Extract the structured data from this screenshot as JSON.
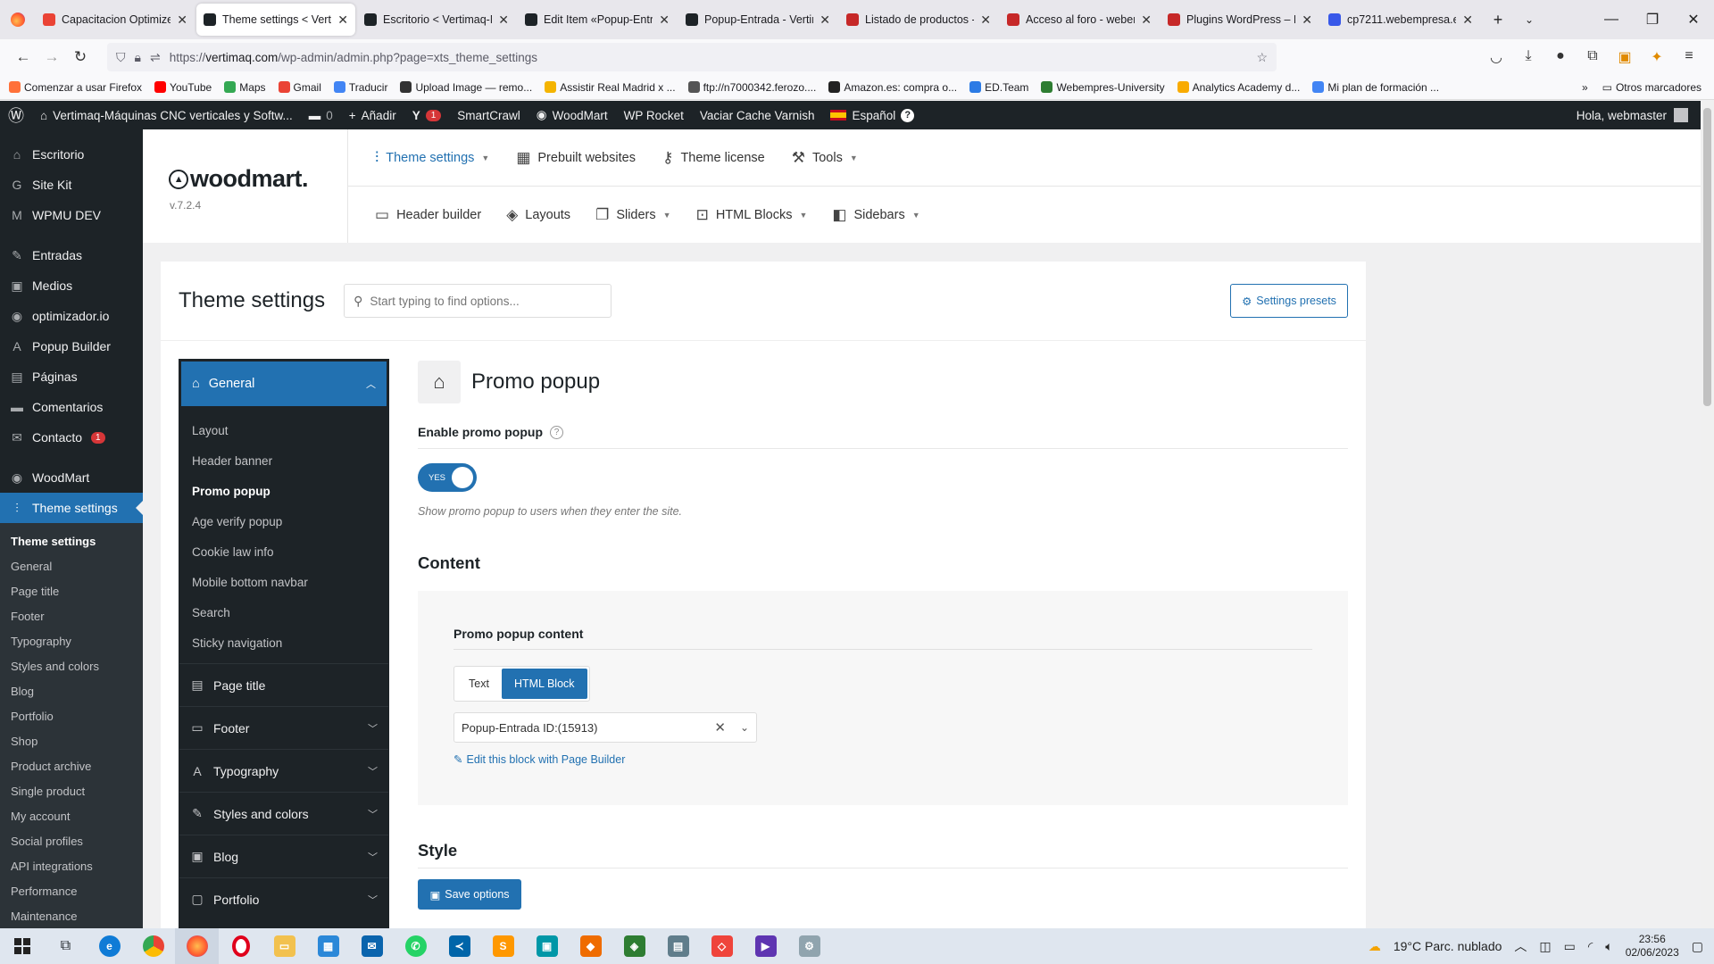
{
  "browser": {
    "tabs": [
      {
        "label": "Capacitacion Optimize",
        "favicon_color": "#ea4335",
        "active": false
      },
      {
        "label": "Theme settings < Verti",
        "favicon_color": "#1d2327",
        "active": true
      },
      {
        "label": "Escritorio < Vertimaq-N",
        "favicon_color": "#1d2327",
        "active": false
      },
      {
        "label": "Edit Item «Popup-Entra",
        "favicon_color": "#1d2327",
        "active": false
      },
      {
        "label": "Popup-Entrada - Vertim",
        "favicon_color": "#1d2327",
        "active": false
      },
      {
        "label": "Listado de productos -",
        "favicon_color": "#c62828",
        "active": false
      },
      {
        "label": "Acceso al foro - webem",
        "favicon_color": "#c62828",
        "active": false
      },
      {
        "label": "Plugins WordPress – Fo",
        "favicon_color": "#c62828",
        "active": false
      },
      {
        "label": "cp7211.webempresa.eu",
        "favicon_color": "#3858e9",
        "active": false
      }
    ],
    "url_prefix": "https://",
    "url_host": "vertimaq.com",
    "url_path": "/wp-admin/admin.php?page=xts_theme_settings",
    "bookmarks": [
      {
        "label": "Comenzar a usar Firefox",
        "color": "#ff7139"
      },
      {
        "label": "YouTube",
        "color": "#ff0000"
      },
      {
        "label": "Maps",
        "color": "#34a853"
      },
      {
        "label": "Gmail",
        "color": "#ea4335"
      },
      {
        "label": "Traducir",
        "color": "#4285f4"
      },
      {
        "label": "Upload Image — remo...",
        "color": "#333333"
      },
      {
        "label": "Assistir Real Madrid x ...",
        "color": "#f4b400"
      },
      {
        "label": "ftp://n7000342.ferozo....",
        "color": "#555555"
      },
      {
        "label": "Amazon.es: compra o...",
        "color": "#222222"
      },
      {
        "label": "ED.Team",
        "color": "#2c7be5"
      },
      {
        "label": "Webempres-University",
        "color": "#2e7d32"
      },
      {
        "label": "Analytics Academy d...",
        "color": "#f9ab00"
      },
      {
        "label": "Mi plan de formación ...",
        "color": "#4285f4"
      }
    ],
    "other_bookmarks": "Otros marcadores"
  },
  "adminbar": {
    "site_name": "Vertimaq-Máquinas CNC verticales y Softw...",
    "comments_count": "0",
    "add_new": "Añadir",
    "yoast_count": "1",
    "smartcrawl": "SmartCrawl",
    "woodmart": "WoodMart",
    "wp_rocket": "WP Rocket",
    "varnish": "Vaciar Cache Varnish",
    "language": "Español",
    "greeting": "Hola, webmaster"
  },
  "wpmenu": {
    "items_top": [
      {
        "label": "Escritorio",
        "icon": "dashboard-icon",
        "glyph": "⌂"
      },
      {
        "label": "Site Kit",
        "icon": "sitekit-icon",
        "glyph": "G"
      },
      {
        "label": "WPMU DEV",
        "icon": "wpmudev-icon",
        "glyph": "M"
      }
    ],
    "items_mid": [
      {
        "label": "Entradas",
        "icon": "pin-icon",
        "glyph": "✎"
      },
      {
        "label": "Medios",
        "icon": "media-icon",
        "glyph": "▣"
      },
      {
        "label": "optimizador.io",
        "icon": "optimizer-icon",
        "glyph": "◉"
      },
      {
        "label": "Popup Builder",
        "icon": "popup-icon",
        "glyph": "A"
      },
      {
        "label": "Páginas",
        "icon": "pages-icon",
        "glyph": "▤"
      },
      {
        "label": "Comentarios",
        "icon": "comments-icon",
        "glyph": "▬"
      },
      {
        "label": "Contacto",
        "icon": "mail-icon",
        "glyph": "✉",
        "badge": "1"
      }
    ],
    "woodmart": "WoodMart",
    "theme_settings": "Theme settings",
    "submenu": [
      "Theme settings",
      "General",
      "Page title",
      "Footer",
      "Typography",
      "Styles and colors",
      "Blog",
      "Portfolio",
      "Shop",
      "Product archive",
      "Single product",
      "My account",
      "Social profiles",
      "API integrations",
      "Performance",
      "Maintenance"
    ]
  },
  "woodmart_header": {
    "logo": "woodmart.",
    "version": "v.7.2.4",
    "row1": [
      {
        "label": "Theme settings",
        "icon": "sliders-icon",
        "glyph": "⫶",
        "caret": true,
        "active": true
      },
      {
        "label": "Prebuilt websites",
        "icon": "grid-icon",
        "glyph": "▦",
        "caret": false,
        "active": false
      },
      {
        "label": "Theme license",
        "icon": "key-icon",
        "glyph": "⚷",
        "caret": false,
        "active": false
      },
      {
        "label": "Tools",
        "icon": "wrench-icon",
        "glyph": "⚒",
        "caret": true,
        "active": false
      }
    ],
    "row2": [
      {
        "label": "Header builder",
        "icon": "header-icon",
        "glyph": "▭",
        "caret": false
      },
      {
        "label": "Layouts",
        "icon": "layers-icon",
        "glyph": "◈",
        "caret": false
      },
      {
        "label": "Sliders",
        "icon": "slides-icon",
        "glyph": "❐",
        "caret": true
      },
      {
        "label": "HTML Blocks",
        "icon": "code-block-icon",
        "glyph": "⊡",
        "caret": true
      },
      {
        "label": "Sidebars",
        "icon": "sidebar-icon",
        "glyph": "◧",
        "caret": true
      }
    ]
  },
  "settings": {
    "title": "Theme settings",
    "search_placeholder": "Start typing to find options...",
    "presets": "Settings presets",
    "nav": {
      "head": "General",
      "subs": [
        "Layout",
        "Header banner",
        "Promo popup",
        "Age verify popup",
        "Cookie law info",
        "Mobile bottom navbar",
        "Search",
        "Sticky navigation"
      ],
      "current_sub": "Promo popup",
      "groups": [
        {
          "label": "Page title",
          "icon": "page-title-icon",
          "glyph": "▤",
          "chevron": false
        },
        {
          "label": "Footer",
          "icon": "footer-icon",
          "glyph": "▭",
          "chevron": true
        },
        {
          "label": "Typography",
          "icon": "typography-icon",
          "glyph": "A",
          "chevron": true
        },
        {
          "label": "Styles and colors",
          "icon": "brush-icon",
          "glyph": "✎",
          "chevron": true
        },
        {
          "label": "Blog",
          "icon": "blog-icon",
          "glyph": "▣",
          "chevron": true
        },
        {
          "label": "Portfolio",
          "icon": "portfolio-icon",
          "glyph": "▢",
          "chevron": true
        }
      ]
    },
    "content": {
      "title": "Promo popup",
      "enable_label": "Enable promo popup",
      "toggle_text": "YES",
      "enable_desc": "Show promo popup to users when they enter the site.",
      "section_content": "Content",
      "popup_content_label": "Promo popup content",
      "segment": [
        "Text",
        "HTML Block"
      ],
      "segment_active": "HTML Block",
      "select_value": "Popup-Entrada ID:(15913)",
      "edit_link": "Edit this block with Page Builder",
      "section_style": "Style",
      "save": "Save options"
    }
  },
  "taskbar": {
    "weather": "19°C  Parc. nublado",
    "time": "23:56",
    "date": "02/06/2023"
  },
  "colors": {
    "wp_dark": "#1d2327",
    "wp_blue": "#2271b1",
    "badge_red": "#d63638"
  }
}
